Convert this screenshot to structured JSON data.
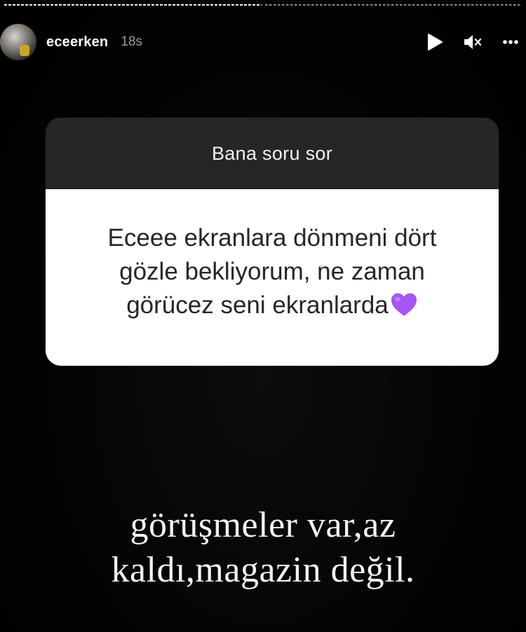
{
  "progress": {
    "segments": 2,
    "current": 1
  },
  "header": {
    "username": "eceerken",
    "timestamp": "18s",
    "controls": [
      "play-icon",
      "mute-icon",
      "more-icon"
    ]
  },
  "question_sticker": {
    "title": "Bana soru sor",
    "question_lines": [
      "Eceee ekranlara dönmeni dört",
      "gözle bekliyorum, ne zaman",
      "görücez seni ekranlarda"
    ],
    "emoji": "purple-heart-icon"
  },
  "reply": {
    "lines": [
      "görüşmeler var,az",
      "kaldı,magazin değil."
    ]
  },
  "colors": {
    "background": "#000000",
    "sticker_header": "#262626",
    "sticker_body": "#ffffff",
    "heart": "#a855f7"
  }
}
